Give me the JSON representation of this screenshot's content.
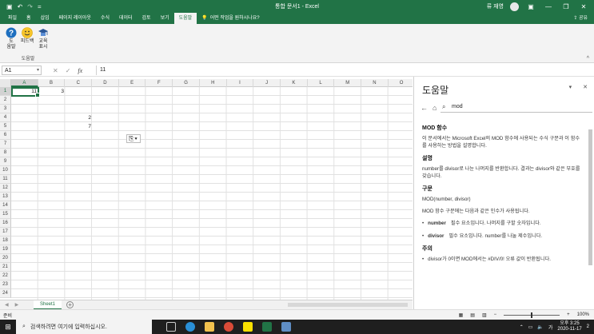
{
  "window": {
    "title": "통합 문서1 - Excel",
    "user": "류 재영",
    "quick_access": {
      "save_icon": "save-icon",
      "undo_icon": "undo-icon",
      "redo_icon": "redo-icon",
      "customize": "="
    },
    "controls": {
      "ribbon_display": "▣",
      "minimize": "—",
      "restore": "❐",
      "close": "✕"
    }
  },
  "menu": {
    "tabs": [
      "파일",
      "홈",
      "삽입",
      "페이지 레이아웃",
      "수식",
      "데이터",
      "검토",
      "보기",
      "도움말"
    ],
    "active_tab": "도움말",
    "tell_me": "어떤 작업을 원하시나요?",
    "share": "공유"
  },
  "ribbon": {
    "buttons": [
      {
        "label_line1": "도",
        "label_line2": "움말",
        "icon": "help-icon"
      },
      {
        "label_line1": "피드백",
        "label_line2": "",
        "icon": "feedback-smiley-icon"
      },
      {
        "label_line1": "교육",
        "label_line2": "표시",
        "icon": "training-icon"
      }
    ],
    "group_label": "도움말",
    "collapse": "^"
  },
  "formula_bar": {
    "name_box": "A1",
    "value": "11",
    "cancel": "✕",
    "enter": "✓",
    "fx": "fx"
  },
  "sheet": {
    "columns": [
      "A",
      "B",
      "C",
      "D",
      "E",
      "F",
      "G",
      "H",
      "I",
      "J",
      "K",
      "L",
      "M",
      "N",
      "O"
    ],
    "rows": [
      "1",
      "2",
      "3",
      "4",
      "5",
      "6",
      "7",
      "8",
      "9",
      "10",
      "11",
      "12",
      "13",
      "14",
      "15",
      "16",
      "17",
      "18",
      "19",
      "20",
      "21",
      "22",
      "23",
      "24"
    ],
    "cells": {
      "A1": "11",
      "B1": "3",
      "C4": "2",
      "C5": "7"
    },
    "paste_options": "⎘▾",
    "tabs": [
      "Sheet1"
    ],
    "add_sheet": "+",
    "status": "준비",
    "zoom": "100%"
  },
  "help_pane": {
    "title": "도움말",
    "search_value": "mod",
    "sections": {
      "title": "MOD 함수",
      "intro": "이 문서에서는 Microsoft Excel의 MOD 함수에 사용되는 수식 구문과 이 함수를 사용하는 방법을 설명합니다.",
      "desc_h": "설명",
      "desc": "number를 divisor로 나눈 나머지를 반환합니다. 결과는 divisor와 같은 부호를 갖습니다.",
      "syntax_h": "구문",
      "syntax": "MOD(number, divisor)",
      "syntax_note": "MOD 함수 구문에는 다음과 같은 인수가 사용됩니다.",
      "arg1_name": "number",
      "arg1_desc": "필수 요소입니다. 나머지를 구할 숫자입니다.",
      "arg2_name": "divisor",
      "arg2_desc": "필수 요소입니다. number를 나눌 제수입니다.",
      "note_h": "주의",
      "note1": "divisor가 0이면 MOD에서는 #DIV/0! 오류 값이 반환됩니다."
    }
  },
  "taskbar": {
    "search_placeholder": "검색하려면 여기에 입력하십시오.",
    "time": "오후 3:25",
    "date": "2020-11-17",
    "notifications": "2"
  },
  "colors": {
    "excel_green": "#217346",
    "taskbar": "#1f1f1f"
  }
}
